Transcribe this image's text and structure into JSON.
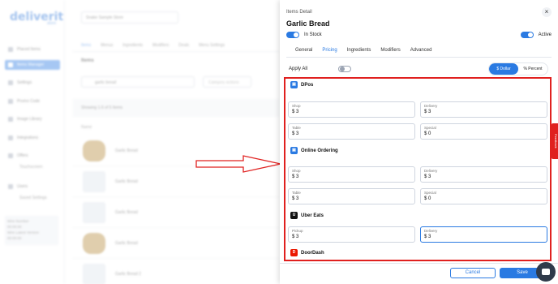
{
  "app": {
    "brand": "deliverit",
    "brand_sub": "store"
  },
  "sidebar": {
    "items": [
      {
        "label": "Placed Items"
      },
      {
        "label": "Items Manager"
      },
      {
        "label": "Settings"
      },
      {
        "label": "Promo Code"
      },
      {
        "label": "Image Library"
      },
      {
        "label": "Integrations"
      },
      {
        "label": "Offers"
      },
      {
        "label": "Users"
      }
    ],
    "subitems": [
      "Touchscreen",
      "Saved Settings"
    ],
    "footer_lines": [
      "Wire Number",
      "00:00:00",
      "Wire Latest Version",
      "00:00:00"
    ]
  },
  "background": {
    "store_select": "Snake Sample Store",
    "tabs": [
      "Items",
      "Menus",
      "Ingredients",
      "Modifiers",
      "Deals",
      "Menu Settings"
    ],
    "items_heading": "Items",
    "search_value": "garlic bread",
    "category_placeholder": "Category actions",
    "showing_text": "Showing 1-5 of 5 Items",
    "name_col": "Name",
    "rows": [
      "Garlic Bread",
      "Garlic Bread",
      "Garlic Bread",
      "Garlic Bread",
      "Garlic Bread 2"
    ]
  },
  "panel": {
    "label": "Items Detail",
    "title": "Garlic Bread",
    "close": "×",
    "in_stock_label": "In Stock",
    "active_label": "Active",
    "tabs": [
      "General",
      "Pricing",
      "Ingredients",
      "Modifiers",
      "Advanced"
    ],
    "apply_all_label": "Apply All",
    "mode_dollar": "$ Dollar",
    "mode_percent": "% Percent",
    "sections": {
      "dpos": {
        "title": "DPos",
        "shop": {
          "label": "Shop",
          "value": "$ 3"
        },
        "delivery": {
          "label": "Delivery",
          "value": "$ 3"
        },
        "table": {
          "label": "Table",
          "value": "$ 3"
        },
        "special": {
          "label": "Special",
          "value": "$ 0"
        }
      },
      "online": {
        "title": "Online Ordering",
        "shop": {
          "label": "Shop",
          "value": "$ 3"
        },
        "delivery": {
          "label": "Delivery",
          "value": "$ 3"
        },
        "table": {
          "label": "Table",
          "value": "$ 3"
        },
        "special": {
          "label": "Special",
          "value": "$ 0"
        }
      },
      "uber": {
        "title": "Uber Eats",
        "pickup": {
          "label": "Pickup",
          "value": "$ 3"
        },
        "delivery": {
          "label": "Delivery",
          "value": "$ 3"
        }
      },
      "doordash": {
        "title": "DoorDash"
      }
    },
    "feedback": "Feedback",
    "cancel": "Cancel",
    "save": "Save"
  },
  "colors": {
    "accent": "#2a7ae2",
    "highlight": "#e0201f"
  }
}
